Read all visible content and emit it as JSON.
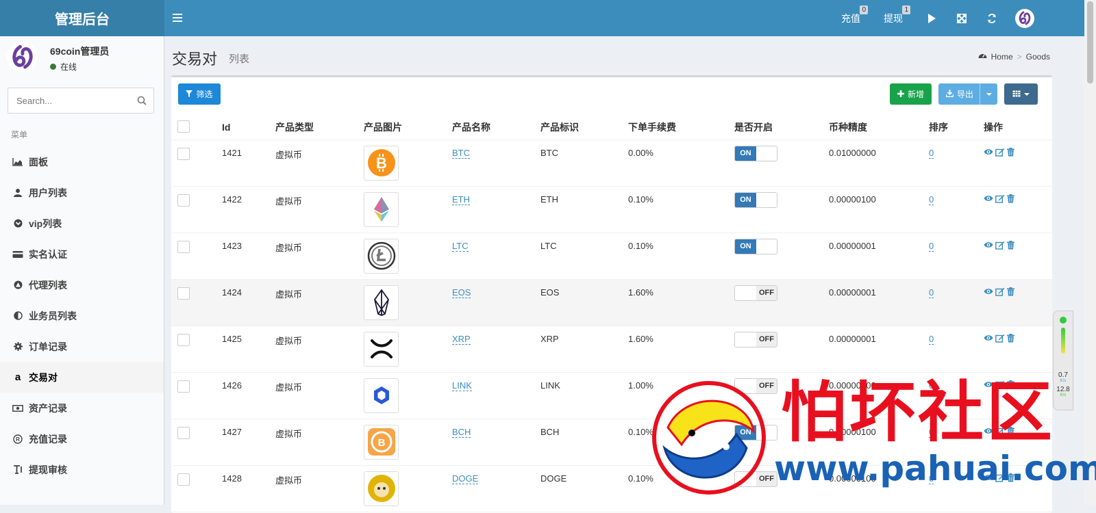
{
  "app": {
    "title": "管理后台"
  },
  "header": {
    "recharge_label": "充值",
    "recharge_badge": "0",
    "withdraw_label": "提现",
    "withdraw_badge": "1"
  },
  "user": {
    "name": "69coin管理员",
    "status": "在线"
  },
  "search": {
    "placeholder": "Search..."
  },
  "sidebar": {
    "header": "菜单",
    "items": [
      {
        "label": "面板",
        "icon": "area-chart-icon"
      },
      {
        "label": "用户列表",
        "icon": "user-icon"
      },
      {
        "label": "vip列表",
        "icon": "chevron-circle-icon"
      },
      {
        "label": "实名认证",
        "icon": "id-card-icon"
      },
      {
        "label": "代理列表",
        "icon": "triangle-circle-icon"
      },
      {
        "label": "业务员列表",
        "icon": "half-circle-icon"
      },
      {
        "label": "订单记录",
        "icon": "cog-icon"
      },
      {
        "label": "交易对",
        "icon": "amazon-icon",
        "active": true
      },
      {
        "label": "资产记录",
        "icon": "money-icon"
      },
      {
        "label": "充值记录",
        "icon": "registered-icon"
      },
      {
        "label": "提现审核",
        "icon": "text-height-icon"
      }
    ]
  },
  "page": {
    "title": "交易对",
    "subtitle": "列表"
  },
  "breadcrumb": {
    "home": "Home",
    "current": "Goods"
  },
  "toolbar": {
    "filter": "筛选",
    "add": "新增",
    "export": "导出"
  },
  "table": {
    "headers": [
      "Id",
      "产品类型",
      "产品图片",
      "产品名称",
      "产品标识",
      "下单手续费",
      "是否开启",
      "币种精度",
      "排序",
      "操作"
    ],
    "rows": [
      {
        "id": "1421",
        "type": "虚拟币",
        "name": "BTC",
        "symbol": "BTC",
        "fee": "0.00%",
        "enabled": true,
        "precision": "0.01000000",
        "sort": "0",
        "image_icon": "btc-icon"
      },
      {
        "id": "1422",
        "type": "虚拟币",
        "name": "ETH",
        "symbol": "ETH",
        "fee": "0.10%",
        "enabled": true,
        "precision": "0.00000100",
        "sort": "0",
        "image_icon": "eth-icon"
      },
      {
        "id": "1423",
        "type": "虚拟币",
        "name": "LTC",
        "symbol": "LTC",
        "fee": "0.10%",
        "enabled": true,
        "precision": "0.00000001",
        "sort": "0",
        "image_icon": "ltc-icon"
      },
      {
        "id": "1424",
        "type": "虚拟币",
        "name": "EOS",
        "symbol": "EOS",
        "fee": "1.60%",
        "enabled": false,
        "precision": "0.00000001",
        "sort": "0",
        "image_icon": "eos-icon"
      },
      {
        "id": "1425",
        "type": "虚拟币",
        "name": "XRP",
        "symbol": "XRP",
        "fee": "1.60%",
        "enabled": false,
        "precision": "0.00000001",
        "sort": "0",
        "image_icon": "xrp-icon"
      },
      {
        "id": "1426",
        "type": "虚拟币",
        "name": "LINK",
        "symbol": "LINK",
        "fee": "1.00%",
        "enabled": false,
        "precision": "0.00000100",
        "sort": "0",
        "image_icon": "link-icon"
      },
      {
        "id": "1427",
        "type": "虚拟币",
        "name": "BCH",
        "symbol": "BCH",
        "fee": "0.10%",
        "enabled": true,
        "precision": "0.00000100",
        "sort": "0",
        "image_icon": "bch-icon"
      },
      {
        "id": "1428",
        "type": "虚拟币",
        "name": "DOGE",
        "symbol": "DOGE",
        "fee": "0.10%",
        "enabled": false,
        "precision": "0.00000100",
        "sort": "0",
        "image_icon": "doge-icon"
      }
    ],
    "toggle_on": "ON",
    "toggle_off": "OFF"
  },
  "speed_widget": {
    "up": "0.7",
    "up_unit": "K/s",
    "down": "12.8",
    "down_unit": "K/s"
  },
  "watermark": {
    "text": "怕坏社区",
    "url": "www.pahuai.com"
  },
  "colors": {
    "header": "#3c8dbc",
    "logo_bg": "#367fa9",
    "add_button": "#18a34a",
    "filter_button": "#1e88d8",
    "toggle_on": "#337ab7",
    "watermark_red": "#e8101e",
    "watermark_blue": "#1a62b5"
  }
}
